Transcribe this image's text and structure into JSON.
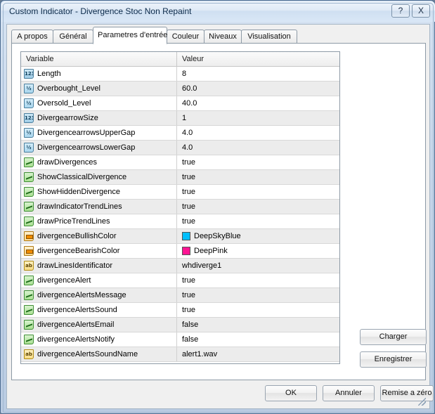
{
  "window": {
    "title": "Custom Indicator - Divergence Stoc Non Repaint",
    "help_label": "?",
    "close_label": "X"
  },
  "tabs": [
    {
      "label": "A propos",
      "active": false
    },
    {
      "label": "Général",
      "active": false
    },
    {
      "label": "Parametres d'entrée",
      "active": true
    },
    {
      "label": "Couleur",
      "active": false
    },
    {
      "label": "Niveaux",
      "active": false
    },
    {
      "label": "Visualisation",
      "active": false
    }
  ],
  "grid": {
    "headers": {
      "variable": "Variable",
      "value": "Valeur"
    },
    "rows": [
      {
        "icon": "int",
        "name": "Length",
        "value": "8"
      },
      {
        "icon": "dbl",
        "name": "Overbought_Level",
        "value": "60.0"
      },
      {
        "icon": "dbl",
        "name": "Oversold_Level",
        "value": "40.0"
      },
      {
        "icon": "int",
        "name": "DivergearrowSize",
        "value": "1"
      },
      {
        "icon": "dbl",
        "name": "DivergencearrowsUpperGap",
        "value": "4.0"
      },
      {
        "icon": "dbl",
        "name": "DivergencearrowsLowerGap",
        "value": "4.0"
      },
      {
        "icon": "bool",
        "name": "drawDivergences",
        "value": "true"
      },
      {
        "icon": "bool",
        "name": "ShowClassicalDivergence",
        "value": "true"
      },
      {
        "icon": "bool",
        "name": "ShowHiddenDivergence",
        "value": "true"
      },
      {
        "icon": "bool",
        "name": "drawIndicatorTrendLines",
        "value": "true"
      },
      {
        "icon": "bool",
        "name": "drawPriceTrendLines",
        "value": "true"
      },
      {
        "icon": "color",
        "name": "divergenceBullishColor",
        "value": "DeepSkyBlue",
        "swatch": "#00BFFF"
      },
      {
        "icon": "color",
        "name": "divergenceBearishColor",
        "value": "DeepPink",
        "swatch": "#FF1493"
      },
      {
        "icon": "str",
        "name": "drawLinesIdentificator",
        "value": "whdiverge1"
      },
      {
        "icon": "bool",
        "name": "divergenceAlert",
        "value": "true"
      },
      {
        "icon": "bool",
        "name": "divergenceAlertsMessage",
        "value": "true"
      },
      {
        "icon": "bool",
        "name": "divergenceAlertsSound",
        "value": "true"
      },
      {
        "icon": "bool",
        "name": "divergenceAlertsEmail",
        "value": "false"
      },
      {
        "icon": "bool",
        "name": "divergenceAlertsNotify",
        "value": "false"
      },
      {
        "icon": "str",
        "name": "divergenceAlertsSoundName",
        "value": "alert1.wav"
      }
    ],
    "icon_labels": {
      "int": "123",
      "dbl": "½",
      "str": "ab"
    }
  },
  "side_buttons": {
    "load": "Charger",
    "save": "Enregistrer"
  },
  "bottom_buttons": {
    "ok": "OK",
    "cancel": "Annuler",
    "reset": "Remise a zéro"
  }
}
